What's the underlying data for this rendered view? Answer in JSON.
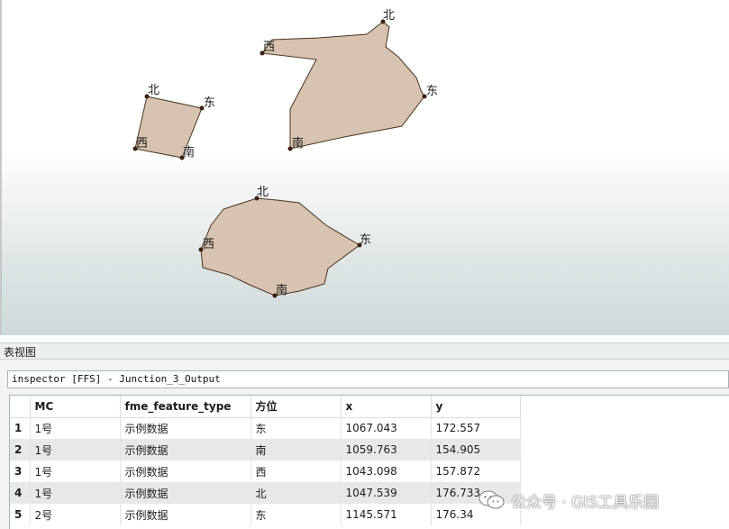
{
  "map": {
    "polygons": [
      {
        "name": "polygon-small",
        "labels": [
          "北",
          "东",
          "南",
          "西"
        ]
      },
      {
        "name": "polygon-large",
        "labels": [
          "北",
          "东",
          "南",
          "西"
        ]
      },
      {
        "name": "polygon-bottom",
        "labels": [
          "北",
          "东",
          "南",
          "西"
        ]
      }
    ],
    "fill_color": "#d7c3af",
    "stroke_color": "#4a3324"
  },
  "panel": {
    "title": "表视图",
    "source": "inspector [FFS] - Junction_3_Output"
  },
  "table": {
    "columns": [
      "MC",
      "fme_feature_type",
      "方位",
      "x",
      "y"
    ],
    "rows": [
      {
        "n": "1",
        "cells": [
          "1号",
          "示例数据",
          "东",
          "1067.043",
          "172.557"
        ]
      },
      {
        "n": "2",
        "cells": [
          "1号",
          "示例数据",
          "南",
          "1059.763",
          "154.905"
        ]
      },
      {
        "n": "3",
        "cells": [
          "1号",
          "示例数据",
          "西",
          "1043.098",
          "157.872"
        ]
      },
      {
        "n": "4",
        "cells": [
          "1号",
          "示例数据",
          "北",
          "1047.539",
          "176.733"
        ]
      },
      {
        "n": "5",
        "cells": [
          "2号",
          "示例数据",
          "东",
          "1145.571",
          "176.34"
        ]
      }
    ]
  },
  "watermark": {
    "text": "公众号 · GIS工具乐园",
    "icon": "wechat-icon"
  }
}
